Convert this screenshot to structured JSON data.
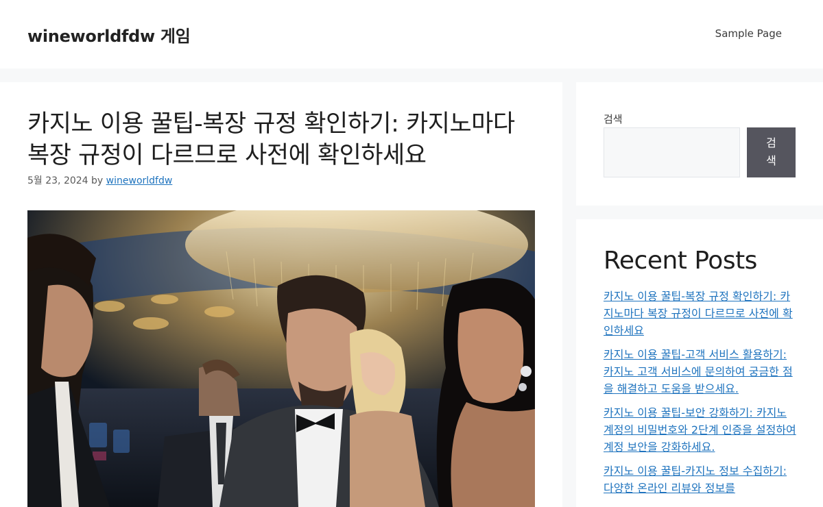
{
  "header": {
    "site_title": "wineworldfdw 게임",
    "nav": [
      {
        "label": "Sample Page"
      }
    ]
  },
  "post": {
    "title": "카지노 이용 꿀팁-복장 규정 확인하기: 카지노마다 복장 규정이 다르므로 사전에 확인하세요",
    "date": "5월 23, 2024",
    "by": "by",
    "author": "wineworldfdw"
  },
  "sidebar": {
    "search": {
      "label": "검색",
      "input_value": "",
      "button_label": "검색"
    },
    "recent_posts": {
      "title": "Recent Posts",
      "items": [
        {
          "label": "카지노 이용 꿀팁-복장 규정 확인하기: 카지노마다 복장 규정이 다르므로 사전에 확인하세요"
        },
        {
          "label": "카지노 이용 꿀팁-고객 서비스 활용하기: 카지노 고객 서비스에 문의하여 궁금한 점을 해결하고 도움을 받으세요."
        },
        {
          "label": "카지노 이용 꿀팁-보안 강화하기: 카지노 계정의 비밀번호와 2단계 인증을 설정하여 계정 보안을 강화하세요."
        },
        {
          "label": "카지노 이용 꿀팁-카지노 정보 수집하기: 다양한 온라인 리뷰와 정보를"
        }
      ]
    }
  },
  "colors": {
    "link": "#1e73be",
    "button": "#55555e",
    "page_bg": "#f7f8f9"
  }
}
